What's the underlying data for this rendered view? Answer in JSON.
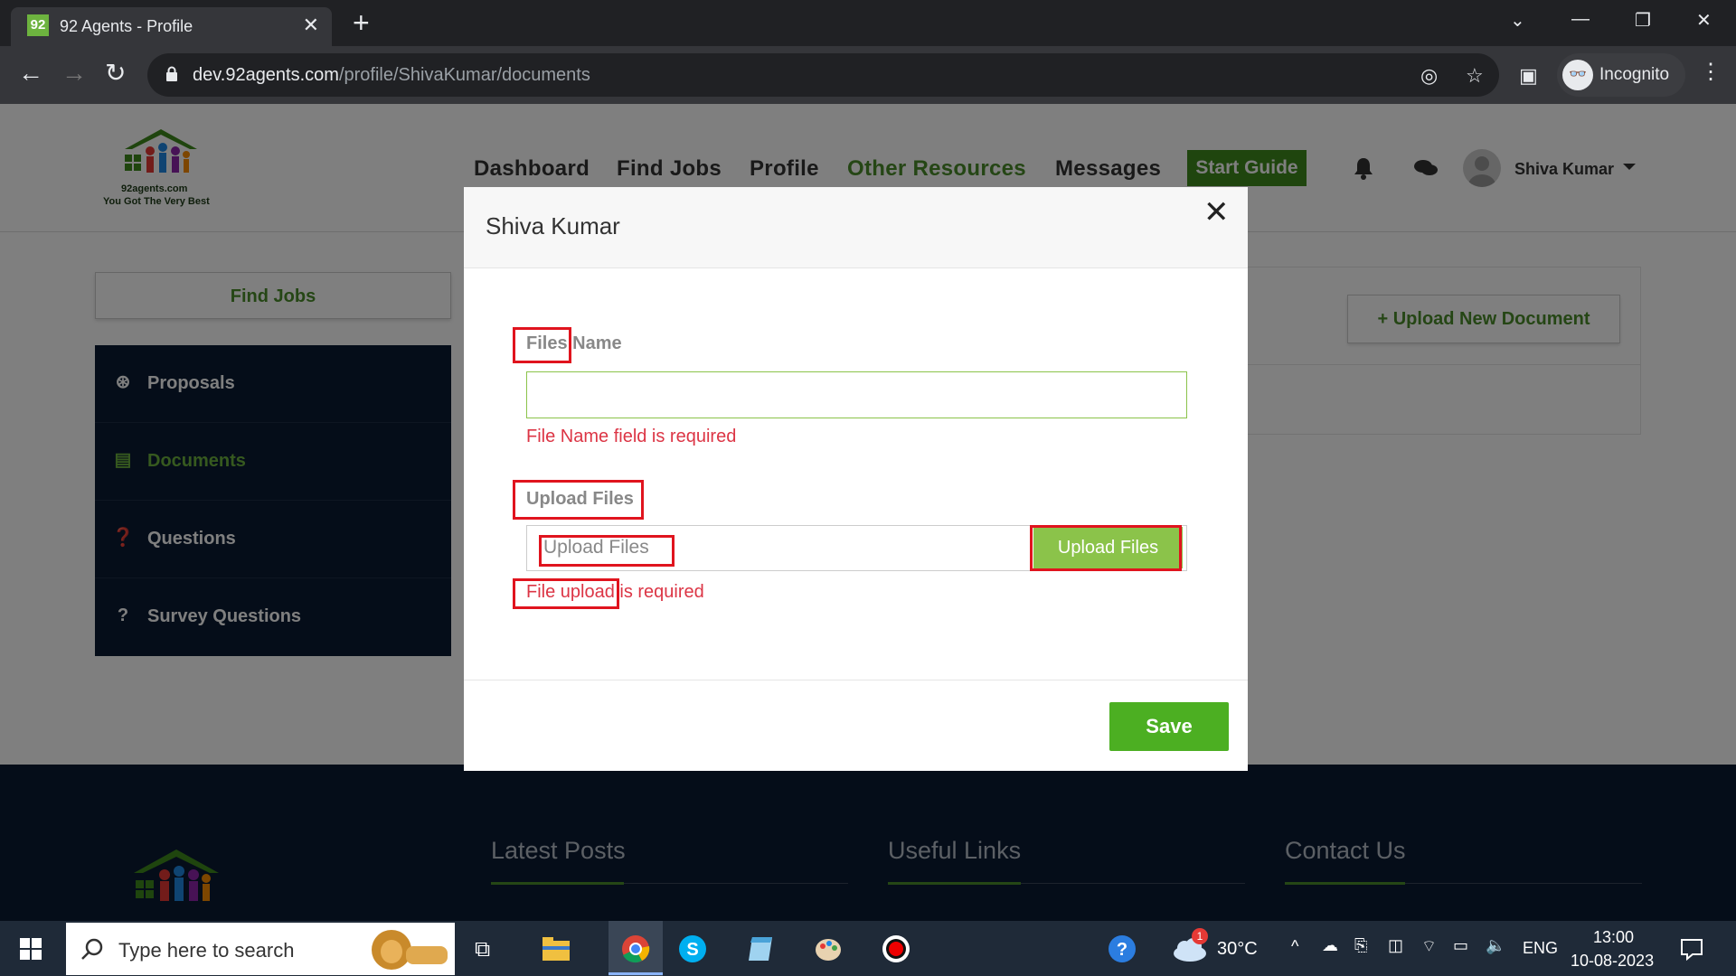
{
  "browser": {
    "tab_title": "92 Agents - Profile",
    "tab_favicon": "92",
    "url_domain": "dev.92agents.com",
    "url_path": "/profile/ShivaKumar/documents",
    "profile_label": "Incognito"
  },
  "site": {
    "logo_caption": "92agents.com",
    "logo_tagline": "You Got The Very Best",
    "nav": [
      "Dashboard",
      "Find Jobs",
      "Profile",
      "Other Resources",
      "Messages"
    ],
    "start_guide": "Start Guide",
    "user_name": "Shiva Kumar"
  },
  "sidebar": {
    "find_jobs": "Find Jobs",
    "items": [
      {
        "label": "Proposals",
        "icon": "gear-asterisk-icon"
      },
      {
        "label": "Documents",
        "icon": "document-icon"
      },
      {
        "label": "Questions",
        "icon": "question-circle-icon"
      },
      {
        "label": "Survey Questions",
        "icon": "question-icon"
      }
    ]
  },
  "documents": {
    "upload_new": "+ Upload New Document"
  },
  "footer": {
    "headings": [
      "Latest Posts",
      "Useful Links",
      "Contact Us"
    ]
  },
  "modal": {
    "title": "Shiva Kumar",
    "file_name_label": "Files Name",
    "file_name_value": "",
    "file_name_error": "File Name field is required",
    "upload_label": "Upload Files",
    "upload_placeholder": "Upload Files",
    "upload_button": "Upload Files",
    "upload_error": "File upload is required",
    "save_button": "Save"
  },
  "taskbar": {
    "search_placeholder": "Type here to search",
    "temperature": "30°C",
    "language": "ENG",
    "time": "13:00",
    "date": "10-08-2023",
    "weather_badge": "1"
  },
  "colors": {
    "brand_green": "#4a8c2a",
    "sidebar_navy": "#0b1b33",
    "error_red": "#dc3545",
    "annotation_red": "#e0141e"
  }
}
